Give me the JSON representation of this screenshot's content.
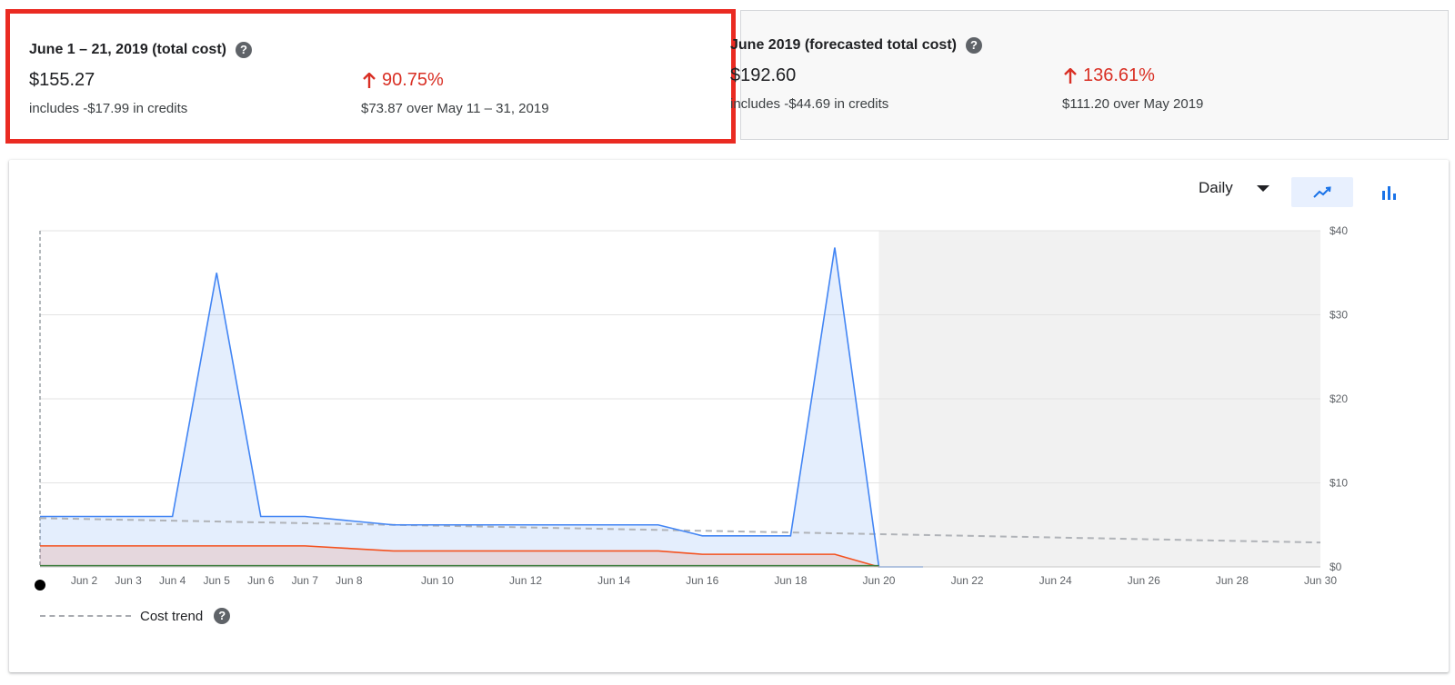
{
  "summary": {
    "current": {
      "title": "June 1 – 21, 2019 (total cost)",
      "amount": "$155.27",
      "credits": "includes -$17.99 in credits",
      "change_pct": "90.75%",
      "change_detail": "$73.87 over May 11 – 31, 2019"
    },
    "forecast": {
      "title": "June 2019 (forecasted total cost)",
      "amount": "$192.60",
      "credits": "includes -$44.69 in credits",
      "change_pct": "136.61%",
      "change_detail": "$111.20 over May 2019"
    },
    "help_glyph": "?"
  },
  "controls": {
    "period": "Daily",
    "line_view_icon": "trending-up-icon",
    "bar_view_icon": "bar-chart-icon"
  },
  "legend": {
    "trend_label": "Cost trend"
  },
  "colors": {
    "accent": "#1a73e8",
    "highlight_border": "#ea2b22",
    "increase": "#d93025",
    "series_blue": "#4285f4",
    "series_orange": "#f4511e"
  },
  "chart_data": {
    "type": "area",
    "x_start_day": 1,
    "x_end_day": 30,
    "x_tick_days": [
      2,
      3,
      4,
      5,
      6,
      7,
      8,
      10,
      12,
      14,
      16,
      18,
      20,
      22,
      24,
      26,
      28,
      30
    ],
    "x_tick_labels": [
      "Jun 2",
      "Jun 3",
      "Jun 4",
      "Jun 5",
      "Jun 6",
      "Jun 7",
      "Jun 8",
      "Jun 10",
      "Jun 12",
      "Jun 14",
      "Jun 16",
      "Jun 18",
      "Jun 20",
      "Jun 22",
      "Jun 24",
      "Jun 26",
      "Jun 28",
      "Jun 30"
    ],
    "ylim": [
      0,
      40
    ],
    "y_ticks": [
      0,
      10,
      20,
      30,
      40
    ],
    "y_tick_labels": [
      "$0",
      "$10",
      "$20",
      "$30",
      "$40"
    ],
    "grid": true,
    "series": [
      {
        "color": "#4285f4",
        "x": [
          1,
          2,
          3,
          4,
          5,
          6,
          7,
          8,
          9,
          10,
          11,
          12,
          13,
          14,
          15,
          16,
          17,
          18,
          19,
          20,
          21
        ],
        "values": [
          6,
          6,
          6,
          6,
          35,
          6,
          6,
          5.5,
          5,
          5,
          5,
          5,
          5,
          5,
          5,
          3.7,
          3.7,
          3.7,
          38,
          0,
          0
        ]
      },
      {
        "color": "#f4511e",
        "x": [
          1,
          2,
          3,
          4,
          5,
          6,
          7,
          8,
          9,
          10,
          11,
          12,
          13,
          14,
          15,
          16,
          17,
          18,
          19,
          20
        ],
        "values": [
          2.5,
          2.5,
          2.5,
          2.5,
          2.5,
          2.5,
          2.5,
          2.2,
          1.9,
          1.9,
          1.9,
          1.9,
          1.9,
          1.9,
          1.9,
          1.5,
          1.5,
          1.5,
          1.5,
          0
        ]
      },
      {
        "color": "#3d7d3d",
        "x": [
          1,
          20
        ],
        "values": [
          0.15,
          0.15
        ]
      }
    ],
    "trend": {
      "x": [
        1,
        2,
        3,
        4,
        5,
        6,
        7,
        8,
        9,
        10,
        11,
        12,
        13,
        14,
        15,
        16,
        17,
        18,
        19,
        20,
        21,
        22,
        23,
        24,
        25,
        26,
        27,
        28,
        29,
        30
      ],
      "values": [
        5.8,
        5.7,
        5.6,
        5.5,
        5.4,
        5.3,
        5.2,
        5.1,
        5.0,
        4.9,
        4.8,
        4.7,
        4.6,
        4.5,
        4.4,
        4.3,
        4.2,
        4.1,
        4.0,
        3.9,
        3.8,
        3.7,
        3.6,
        3.5,
        3.4,
        3.3,
        3.2,
        3.1,
        3.0,
        2.9
      ]
    }
  }
}
